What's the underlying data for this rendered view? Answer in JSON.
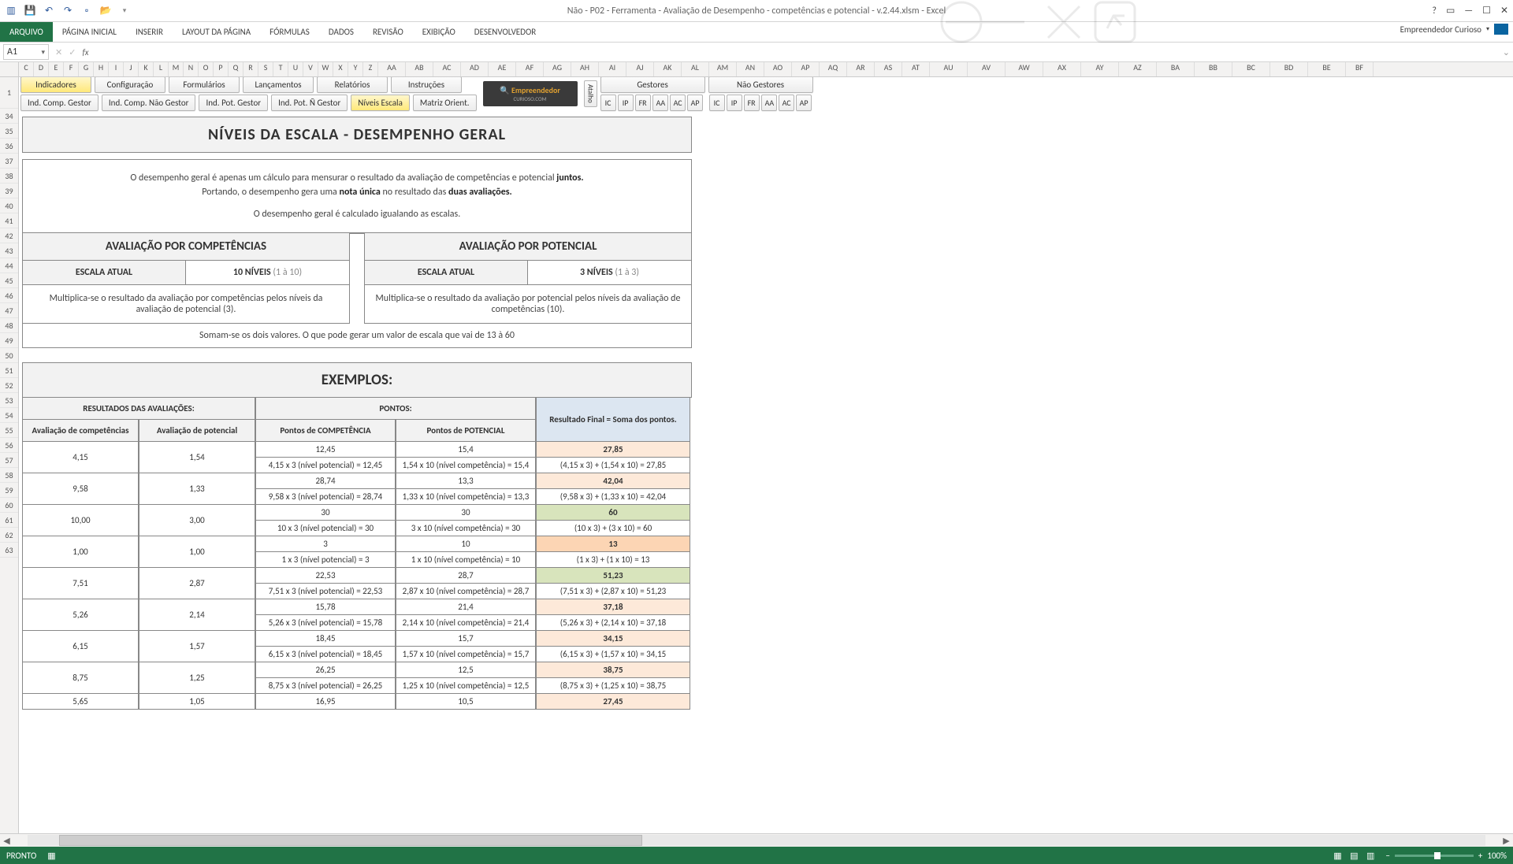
{
  "title": "Não - P02 - Ferramenta - Avaliação de Desempenho - competências e potencial - v.2.44.xlsm - Excel",
  "account": "Empreendedor Curioso",
  "ribbon": [
    "ARQUIVO",
    "PÁGINA INICIAL",
    "INSERIR",
    "LAYOUT DA PÁGINA",
    "FÓRMULAS",
    "DADOS",
    "REVISÃO",
    "EXIBIÇÃO",
    "DESENVOLVEDOR"
  ],
  "namebox": "A1",
  "columns": [
    "C",
    "D",
    "E",
    "F",
    "G",
    "H",
    "I",
    "J",
    "K",
    "L",
    "M",
    "N",
    "O",
    "P",
    "Q",
    "R",
    "S",
    "T",
    "U",
    "V",
    "W",
    "X",
    "Y",
    "Z",
    "AA",
    "AB",
    "AC",
    "AD",
    "AE",
    "AF",
    "AG",
    "AH",
    "AI",
    "AJ",
    "AK",
    "AL",
    "AM",
    "AN",
    "AO",
    "AP",
    "AQ",
    "AR",
    "AS",
    "AT",
    "AU",
    "AV",
    "AW",
    "AX",
    "AY",
    "AZ",
    "BA",
    "BB",
    "BC",
    "BD",
    "BE",
    "BF"
  ],
  "rows": [
    "1",
    "34",
    "35",
    "36",
    "37",
    "38",
    "39",
    "40",
    "41",
    "42",
    "43",
    "44",
    "45",
    "46",
    "47",
    "48",
    "49",
    "50",
    "51",
    "52",
    "53",
    "54",
    "55",
    "56",
    "57",
    "58",
    "59",
    "60",
    "61",
    "62",
    "63"
  ],
  "macrosTop": [
    "Indicadores",
    "Configuração",
    "Formulários",
    "Lançamentos",
    "Relatórios",
    "Instruções"
  ],
  "macrosBottom": [
    "Ind. Comp. Gestor",
    "Ind. Comp. Não Gestor",
    "Ind. Pot. Gestor",
    "Ind. Pot. Ñ Gestor",
    "Níveis Escala",
    "Matriz Orient."
  ],
  "atalho": "Atalho",
  "groups": {
    "g1": "Gestores",
    "g2": "Não Gestores"
  },
  "short": [
    "IC",
    "IP",
    "FR",
    "AA",
    "AC",
    "AP"
  ],
  "logo": {
    "l1": "Empreendedor",
    "l2": "CURIOSO.COM"
  },
  "section": {
    "title": "NÍVEIS DA ESCALA - DESEMPENHO GERAL",
    "p1a": "O desempenho geral é apenas um cálculo para mensurar o resultado da avaliação de competências e potencial ",
    "p1b": "juntos.",
    "p2a": "Portando, o desempenho gera uma ",
    "p2b": "nota única",
    "p2c": " no resultado das ",
    "p2d": "duas avaliações.",
    "p3": "O desempenho geral é calculado igualando as escalas.",
    "compTitle": "AVALIAÇÃO POR COMPETÊNCIAS",
    "potTitle": "AVALIAÇÃO POR POTENCIAL",
    "escala": "ESCALA ATUAL",
    "compNiv": "10 NÍVEIS ",
    "compNivDim": "(1 à 10)",
    "potNiv": "3 NÍVEIS ",
    "potNivDim": "(1 à 3)",
    "compExpl": "Multiplica-se o resultado da avaliação por competências pelos níveis da avaliação de potencial (3).",
    "potExpl": "Multiplica-se o resultado da avaliação por potencial pelos níveis da avaliação de competências (10).",
    "sum": "Somam-se os dois valores. O que pode gerar um valor de escala que vai de 13 à 60"
  },
  "examples": {
    "title": "EXEMPLOS:",
    "hRes": "RESULTADOS DAS AVALIAÇÕES:",
    "hPon": "PONTOS:",
    "hFinal": "Resultado Final = Soma dos pontos.",
    "subH": [
      "Avaliação de competências",
      "Avaliação de potencial",
      "Pontos de COMPETÊNCIA",
      "Pontos de POTENCIAL"
    ],
    "rows": [
      {
        "ac": "4,15",
        "ap": "1,54",
        "pc": "12,45",
        "pcf": "4,15 x 3 (nível potencial) = 12,45",
        "pp": "15,4",
        "ppf": "1,54 x 10 (nível competência) = 15,4",
        "rf": "27,85",
        "rff": "(4,15 x 3) + (1,54 x 10) = 27,85",
        "c": "orange"
      },
      {
        "ac": "9,58",
        "ap": "1,33",
        "pc": "28,74",
        "pcf": "9,58 x 3 (nível potencial) = 28,74",
        "pp": "13,3",
        "ppf": "1,33 x 10 (nível competência) = 13,3",
        "rf": "42,04",
        "rff": "(9,58 x 3) + (1,33 x 10) = 42,04",
        "c": "orange"
      },
      {
        "ac": "10,00",
        "ap": "3,00",
        "pc": "30",
        "pcf": "10 x 3 (nível potencial) = 30",
        "pp": "30",
        "ppf": "3 x 10 (nível competência) = 30",
        "rf": "60",
        "rff": "(10 x 3) + (3 x 10) = 60",
        "c": "green"
      },
      {
        "ac": "1,00",
        "ap": "1,00",
        "pc": "3",
        "pcf": "1 x 3 (nível potencial) = 3",
        "pp": "10",
        "ppf": "1 x 10 (nível competência) = 10",
        "rf": "13",
        "rff": "(1 x 3) + (1 x 10) = 13",
        "c": "peach"
      },
      {
        "ac": "7,51",
        "ap": "2,87",
        "pc": "22,53",
        "pcf": "7,51 x 3 (nível potencial) = 22,53",
        "pp": "28,7",
        "ppf": "2,87 x 10 (nível competência) = 28,7",
        "rf": "51,23",
        "rff": "(7,51 x 3) + (2,87 x 10) = 51,23",
        "c": "green"
      },
      {
        "ac": "5,26",
        "ap": "2,14",
        "pc": "15,78",
        "pcf": "5,26 x 3 (nível potencial) = 15,78",
        "pp": "21,4",
        "ppf": "2,14 x 10 (nível competência) = 21,4",
        "rf": "37,18",
        "rff": "(5,26 x 3) + (2,14 x 10) = 37,18",
        "c": "orange"
      },
      {
        "ac": "6,15",
        "ap": "1,57",
        "pc": "18,45",
        "pcf": "6,15 x 3 (nível potencial) = 18,45",
        "pp": "15,7",
        "ppf": "1,57 x 10 (nível competência) = 15,7",
        "rf": "34,15",
        "rff": "(6,15 x 3) + (1,57 x 10) = 34,15",
        "c": "orange"
      },
      {
        "ac": "8,75",
        "ap": "1,25",
        "pc": "26,25",
        "pcf": "8,75 x 3 (nível potencial) = 26,25",
        "pp": "12,5",
        "ppf": "1,25 x 10 (nível competência) = 12,5",
        "rf": "38,75",
        "rff": "(8,75 x 3) + (1,25 x 10) = 38,75",
        "c": "orange"
      },
      {
        "ac": "5,65",
        "ap": "1,05",
        "pc": "16,95",
        "pcf": "",
        "pp": "10,5",
        "ppf": "",
        "rf": "27,45",
        "rff": "",
        "c": "orange",
        "partial": true
      }
    ]
  },
  "status": {
    "ready": "PRONTO",
    "zoom": "100%"
  }
}
